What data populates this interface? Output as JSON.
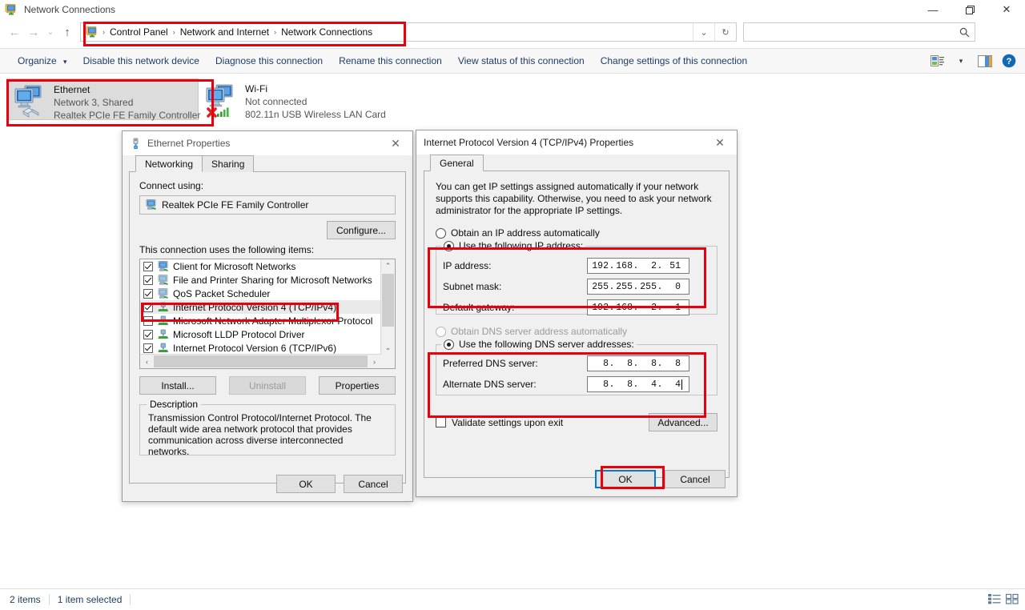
{
  "window": {
    "title": "Network Connections",
    "title_icon": "network-connections-icon",
    "controls": {
      "minimize": "—",
      "maximize": "❐",
      "close": "✕"
    }
  },
  "address_bar": {
    "back": "←",
    "forward": "→",
    "recent": "⌄",
    "up": "↑",
    "icon": "network-connections-icon",
    "breadcrumbs": [
      "Control Panel",
      "Network and Internet",
      "Network Connections"
    ],
    "separator": "›",
    "dropdown": "⌄",
    "refresh": "↻",
    "search_placeholder": "",
    "search_value": "",
    "search_icon": "search-icon"
  },
  "command_bar": {
    "organize": "Organize",
    "organize_caret": "▾",
    "commands": [
      "Disable this network device",
      "Diagnose this connection",
      "Rename this connection",
      "View status of this connection",
      "Change settings of this connection"
    ],
    "view_icon": "view-details-icon",
    "view_caret": "▾",
    "pane_icon": "preview-pane-icon",
    "help_icon": "help-icon"
  },
  "connections": [
    {
      "name": "Ethernet",
      "status": "Network 3, Shared",
      "adapter": "Realtek PCIe FE Family Controller",
      "selected": true,
      "disconnected": false
    },
    {
      "name": "Wi-Fi",
      "status": "Not connected",
      "adapter": "802.11n USB Wireless LAN Card",
      "selected": false,
      "disconnected": true
    }
  ],
  "status_bar": {
    "items_count": "2 items",
    "selection": "1 item selected",
    "details_icon": "details-view-icon",
    "tiles_icon": "large-icons-view-icon"
  },
  "ethernet_properties": {
    "title": "Ethernet Properties",
    "title_icon": "ethernet-port-icon",
    "close": "✕",
    "tabs": [
      {
        "label": "Networking",
        "active": true
      },
      {
        "label": "Sharing",
        "active": false
      }
    ],
    "connect_using_label": "Connect using:",
    "adapter_name": "Realtek PCIe FE Family Controller",
    "configure_button": "Configure...",
    "items_label": "This connection uses the following items:",
    "items": [
      {
        "label": "Client for Microsoft Networks",
        "checked": true,
        "selected": false,
        "icon": "client-icon"
      },
      {
        "label": "File and Printer Sharing for Microsoft Networks",
        "checked": true,
        "selected": false,
        "icon": "sharing-icon"
      },
      {
        "label": "QoS Packet Scheduler",
        "checked": true,
        "selected": false,
        "icon": "qos-icon"
      },
      {
        "label": "Internet Protocol Version 4 (TCP/IPv4)",
        "checked": true,
        "selected": true,
        "icon": "protocol-icon"
      },
      {
        "label": "Microsoft Network Adapter Multiplexor Protocol",
        "checked": false,
        "selected": false,
        "icon": "protocol-icon"
      },
      {
        "label": "Microsoft LLDP Protocol Driver",
        "checked": true,
        "selected": false,
        "icon": "protocol-icon"
      },
      {
        "label": "Internet Protocol Version 6 (TCP/IPv6)",
        "checked": true,
        "selected": false,
        "icon": "protocol-icon"
      }
    ],
    "scroll_up": "⌃",
    "scroll_down": "⌄",
    "scroll_left": "‹",
    "scroll_right": "›",
    "install_button": "Install...",
    "uninstall_button": "Uninstall",
    "properties_button": "Properties",
    "description_legend": "Description",
    "description_text": "Transmission Control Protocol/Internet Protocol. The default wide area network protocol that provides communication across diverse interconnected networks.",
    "ok_button": "OK",
    "cancel_button": "Cancel"
  },
  "tcpip_properties": {
    "title": "Internet Protocol Version 4 (TCP/IPv4) Properties",
    "close": "✕",
    "tabs": [
      {
        "label": "General",
        "active": true
      }
    ],
    "intro_text": "You can get IP settings assigned automatically if your network supports this capability. Otherwise, you need to ask your network administrator for the appropriate IP settings.",
    "obtain_ip_label": "Obtain an IP address automatically",
    "obtain_ip_selected": false,
    "use_ip_label": "Use the following IP address:",
    "use_ip_selected": true,
    "ip_address_label": "IP address:",
    "ip_address": [
      "192",
      "168",
      "2",
      "51"
    ],
    "subnet_mask_label": "Subnet mask:",
    "subnet_mask": [
      "255",
      "255",
      "255",
      "0"
    ],
    "default_gateway_label": "Default gateway:",
    "default_gateway": [
      "192",
      "168",
      "2",
      "1"
    ],
    "obtain_dns_label": "Obtain DNS server address automatically",
    "obtain_dns_selected": false,
    "obtain_dns_disabled": true,
    "use_dns_label": "Use the following DNS server addresses:",
    "use_dns_selected": true,
    "preferred_dns_label": "Preferred DNS server:",
    "preferred_dns": [
      "8",
      "8",
      "8",
      "8"
    ],
    "alternate_dns_label": "Alternate DNS server:",
    "alternate_dns": [
      "8",
      "8",
      "4",
      "4"
    ],
    "alternate_dns_has_caret": true,
    "validate_label": "Validate settings upon exit",
    "validate_checked": false,
    "advanced_button": "Advanced...",
    "ok_button": "OK",
    "cancel_button": "Cancel"
  },
  "annotations": {
    "color": "#e8000d",
    "boxes": [
      "address-bar-breadcrumb",
      "ethernet-connection-item",
      "tcpipv4-list-item",
      "use-following-ip-group",
      "use-following-dns-group",
      "ok-button"
    ]
  }
}
